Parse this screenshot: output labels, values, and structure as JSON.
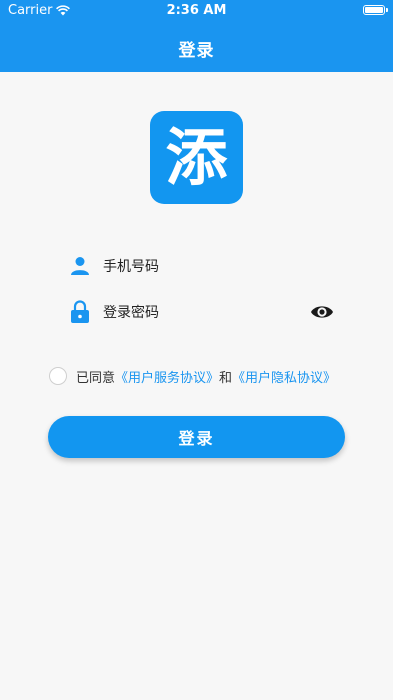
{
  "status_bar": {
    "carrier": "Carrier",
    "time": "2:36 AM"
  },
  "header": {
    "title": "登录"
  },
  "logo": {
    "glyph": "添",
    "icon": "app-logo"
  },
  "form": {
    "phone_label": "手机号码",
    "password_label": "登录密码",
    "phone_icon": "person-icon",
    "password_icon": "lock-icon",
    "visibility_icon": "eye-icon"
  },
  "agreement": {
    "prefix": "已同意",
    "user_service": "《用户服务协议》",
    "connector": "和",
    "privacy": "《用户隐私协议》",
    "checked": false
  },
  "login_button": {
    "label": "登录"
  },
  "colors": {
    "primary": "#1a95f0",
    "background": "#f7f7f7"
  }
}
